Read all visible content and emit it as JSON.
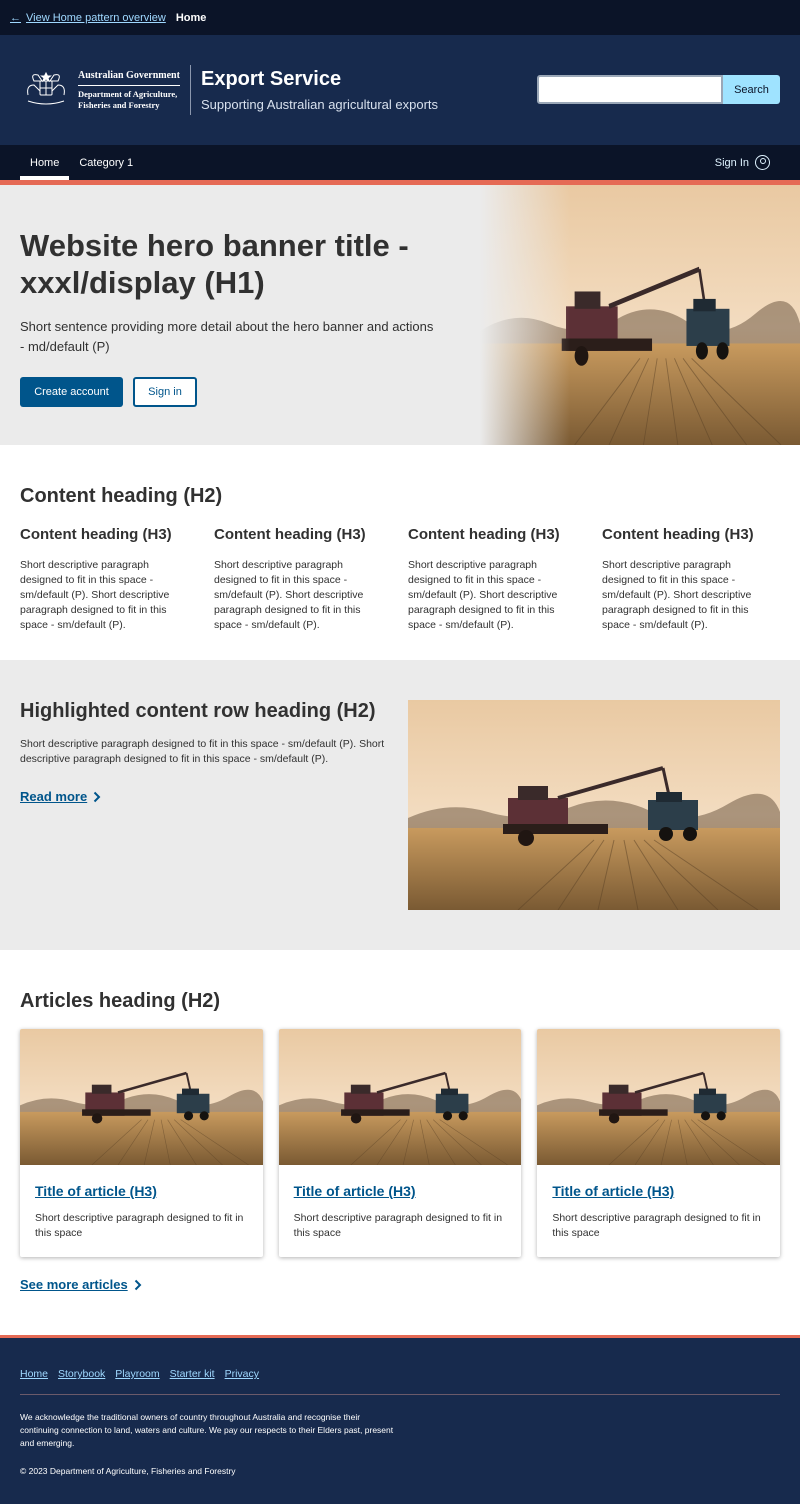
{
  "topbar": {
    "back_link": "View Home pattern overview",
    "crumb": "Home"
  },
  "header": {
    "gov_name": "Australian Government",
    "dept_line1": "Department of Agriculture,",
    "dept_line2": "Fisheries and Forestry",
    "title": "Export Service",
    "subtitle": "Supporting Australian agricultural exports",
    "search_button": "Search",
    "search_value": ""
  },
  "nav": {
    "items": [
      {
        "label": "Home"
      },
      {
        "label": "Category 1"
      }
    ],
    "signin": "Sign In"
  },
  "hero": {
    "title": "Website hero banner title - xxxl/display (H1)",
    "text": "Short sentence providing more detail about the hero banner and actions - md/default (P)",
    "primary": "Create account",
    "secondary": "Sign in"
  },
  "content": {
    "heading": "Content heading (H2)",
    "columns": [
      {
        "heading": "Content heading (H3)",
        "text": "Short descriptive paragraph designed to fit in this space - sm/default (P). Short descriptive paragraph designed to fit in this space - sm/default (P)."
      },
      {
        "heading": "Content heading (H3)",
        "text": "Short descriptive paragraph designed to fit in this space - sm/default (P). Short descriptive paragraph designed to fit in this space - sm/default (P)."
      },
      {
        "heading": "Content heading (H3)",
        "text": "Short descriptive paragraph designed to fit in this space - sm/default (P). Short descriptive paragraph designed to fit in this space - sm/default (P)."
      },
      {
        "heading": "Content heading (H3)",
        "text": "Short descriptive paragraph designed to fit in this space - sm/default (P). Short descriptive paragraph designed to fit in this space - sm/default (P)."
      }
    ]
  },
  "highlight": {
    "heading": "Highlighted content row heading (H2)",
    "text": "Short descriptive paragraph designed to fit in this space - sm/default (P). Short descriptive paragraph designed to fit in this space - sm/default (P).",
    "link": "Read more"
  },
  "articles": {
    "heading": "Articles heading (H2)",
    "cards": [
      {
        "title": "Title of article (H3)",
        "text": "Short descriptive paragraph designed to fit in this space"
      },
      {
        "title": "Title of article (H3)",
        "text": "Short descriptive paragraph designed to fit in this space"
      },
      {
        "title": "Title of article (H3)",
        "text": "Short descriptive paragraph designed to fit in this space"
      }
    ],
    "see_more": "See more articles"
  },
  "footer": {
    "links": [
      "Home",
      "Storybook",
      "Playroom",
      "Starter kit",
      "Privacy"
    ],
    "acknowledgement": "We acknowledge the traditional owners of country throughout Australia and recognise their continuing connection to land, waters and culture. We pay our respects to their Elders past, present and emerging.",
    "copyright": "© 2023 Department of Agriculture, Fisheries and Forestry"
  },
  "colors": {
    "primary": "#00558b",
    "header_bg": "#172a4d",
    "dark_bg": "#0b1428",
    "accent": "#e56a55",
    "search_button": "#9fe3ff",
    "section_bg": "#ebebeb"
  },
  "icons": [
    "arrow-left-icon",
    "government-crest-icon",
    "user-circle-icon",
    "chevron-right-icon"
  ]
}
